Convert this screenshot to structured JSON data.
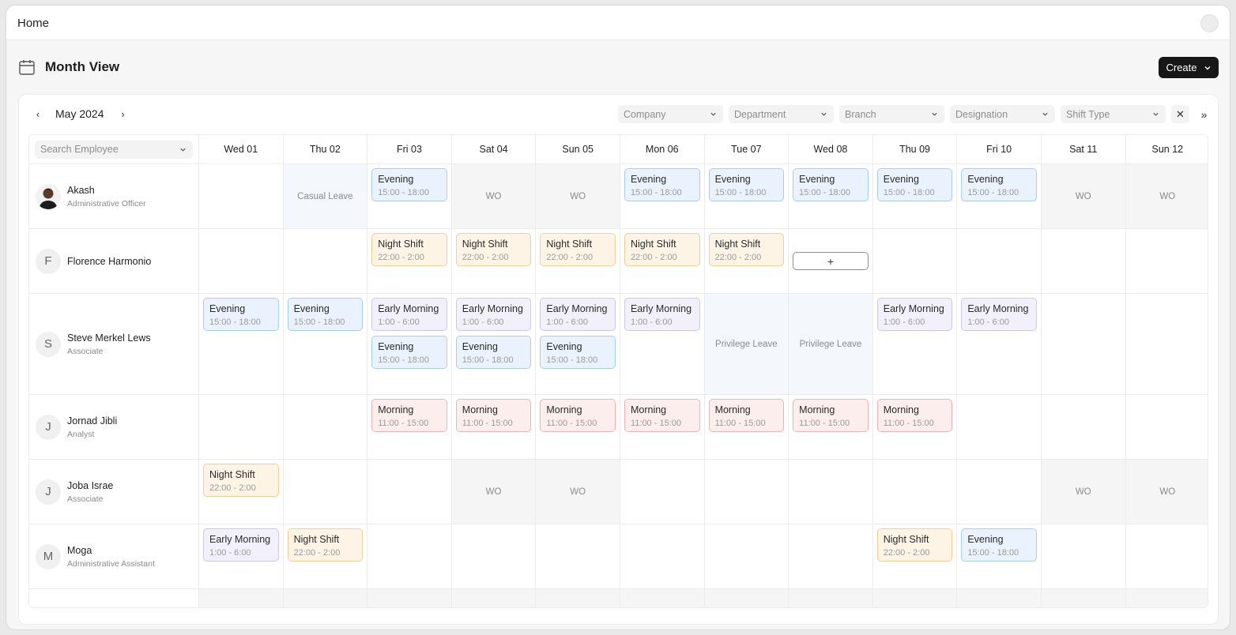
{
  "topbar": {
    "home": "Home"
  },
  "page": {
    "title": "Month View",
    "create_label": "Create"
  },
  "nav": {
    "month": "May 2024",
    "prev": "‹",
    "next": "›"
  },
  "filters": [
    "Company",
    "Department",
    "Branch",
    "Designation",
    "Shift Type"
  ],
  "clear_icon": "✕",
  "more_icon": "»",
  "search": {
    "placeholder": "Search Employee"
  },
  "days": [
    "Wed 01",
    "Thu 02",
    "Fri 03",
    "Sat 04",
    "Sun 05",
    "Mon 06",
    "Tue 07",
    "Wed 08",
    "Thu 09",
    "Fri 10",
    "Sat 11",
    "Sun 12"
  ],
  "shift_types": {
    "evening": {
      "name": "Evening",
      "time": "15:00 - 18:00"
    },
    "night": {
      "name": "Night Shift",
      "time": "22:00 - 2:00"
    },
    "early": {
      "name": "Early Morning",
      "time": "1:00 - 6:00"
    },
    "morning": {
      "name": "Morning",
      "time": "11:00 - 15:00"
    }
  },
  "employees": [
    {
      "name": "Akash",
      "role": "Administrative Officer",
      "initial": "",
      "photo": true,
      "days": [
        {
          "type": "empty"
        },
        {
          "type": "leave",
          "label": "Casual Leave"
        },
        {
          "type": "shifts",
          "shifts": [
            "evening"
          ]
        },
        {
          "type": "wo",
          "label": "WO"
        },
        {
          "type": "wo",
          "label": "WO"
        },
        {
          "type": "shifts",
          "shifts": [
            "evening"
          ]
        },
        {
          "type": "shifts",
          "shifts": [
            "evening"
          ]
        },
        {
          "type": "shifts",
          "shifts": [
            "evening"
          ]
        },
        {
          "type": "shifts",
          "shifts": [
            "evening"
          ]
        },
        {
          "type": "shifts",
          "shifts": [
            "evening"
          ]
        },
        {
          "type": "wo",
          "label": "WO"
        },
        {
          "type": "wo",
          "label": "WO"
        }
      ]
    },
    {
      "name": "Florence Harmonio",
      "role": "",
      "initial": "F",
      "days": [
        {
          "type": "empty"
        },
        {
          "type": "empty"
        },
        {
          "type": "shifts",
          "shifts": [
            "night"
          ]
        },
        {
          "type": "shifts",
          "shifts": [
            "night"
          ]
        },
        {
          "type": "shifts",
          "shifts": [
            "night"
          ]
        },
        {
          "type": "shifts",
          "shifts": [
            "night"
          ]
        },
        {
          "type": "shifts",
          "shifts": [
            "night"
          ]
        },
        {
          "type": "plus",
          "label": "+"
        },
        {
          "type": "empty"
        },
        {
          "type": "empty"
        },
        {
          "type": "empty"
        },
        {
          "type": "empty"
        }
      ]
    },
    {
      "name": "Steve Merkel Lews",
      "role": "Associate",
      "initial": "S",
      "days": [
        {
          "type": "shifts",
          "shifts": [
            "evening"
          ]
        },
        {
          "type": "shifts",
          "shifts": [
            "evening"
          ]
        },
        {
          "type": "shifts",
          "shifts": [
            "early",
            "evening"
          ]
        },
        {
          "type": "shifts",
          "shifts": [
            "early",
            "evening"
          ]
        },
        {
          "type": "shifts",
          "shifts": [
            "early",
            "evening"
          ]
        },
        {
          "type": "shifts",
          "shifts": [
            "early"
          ]
        },
        {
          "type": "leave",
          "label": "Privilege Leave"
        },
        {
          "type": "leave",
          "label": "Privilege Leave"
        },
        {
          "type": "shifts",
          "shifts": [
            "early"
          ]
        },
        {
          "type": "shifts",
          "shifts": [
            "early"
          ]
        },
        {
          "type": "empty"
        },
        {
          "type": "empty"
        }
      ]
    },
    {
      "name": "Jornad Jibli",
      "role": "Analyst",
      "initial": "J",
      "days": [
        {
          "type": "empty"
        },
        {
          "type": "empty"
        },
        {
          "type": "shifts",
          "shifts": [
            "morning"
          ]
        },
        {
          "type": "shifts",
          "shifts": [
            "morning"
          ]
        },
        {
          "type": "shifts",
          "shifts": [
            "morning"
          ]
        },
        {
          "type": "shifts",
          "shifts": [
            "morning"
          ]
        },
        {
          "type": "shifts",
          "shifts": [
            "morning"
          ]
        },
        {
          "type": "shifts",
          "shifts": [
            "morning"
          ]
        },
        {
          "type": "shifts",
          "shifts": [
            "morning"
          ]
        },
        {
          "type": "empty"
        },
        {
          "type": "empty"
        },
        {
          "type": "empty"
        }
      ]
    },
    {
      "name": "Joba Israe",
      "role": "Associate",
      "initial": "J",
      "days": [
        {
          "type": "shifts",
          "shifts": [
            "night"
          ]
        },
        {
          "type": "empty"
        },
        {
          "type": "empty"
        },
        {
          "type": "wo",
          "label": "WO"
        },
        {
          "type": "wo",
          "label": "WO"
        },
        {
          "type": "empty"
        },
        {
          "type": "empty"
        },
        {
          "type": "empty"
        },
        {
          "type": "empty"
        },
        {
          "type": "empty"
        },
        {
          "type": "wo",
          "label": "WO"
        },
        {
          "type": "wo",
          "label": "WO"
        }
      ]
    },
    {
      "name": "Moga",
      "role": "Administrative Assistant",
      "initial": "M",
      "days": [
        {
          "type": "shifts",
          "shifts": [
            "early"
          ]
        },
        {
          "type": "shifts",
          "shifts": [
            "night"
          ]
        },
        {
          "type": "empty"
        },
        {
          "type": "empty"
        },
        {
          "type": "empty"
        },
        {
          "type": "empty"
        },
        {
          "type": "empty"
        },
        {
          "type": "empty"
        },
        {
          "type": "shifts",
          "shifts": [
            "night"
          ]
        },
        {
          "type": "shifts",
          "shifts": [
            "evening"
          ]
        },
        {
          "type": "empty"
        },
        {
          "type": "empty"
        }
      ]
    }
  ]
}
